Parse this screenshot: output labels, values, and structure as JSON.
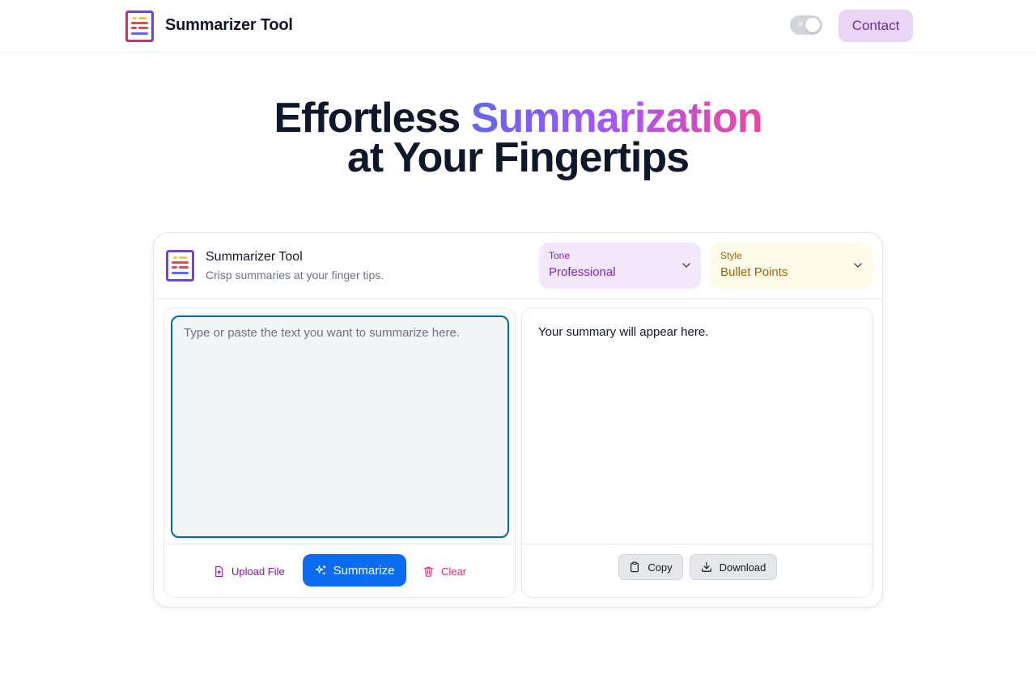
{
  "header": {
    "brand_title": "Summarizer Tool",
    "contact_label": "Contact",
    "logo_icon": "document-lines-icon",
    "theme_icon": "sun-icon"
  },
  "hero": {
    "line1_plain": "Effortless ",
    "line1_highlight": "Summarization",
    "line2": "at Your Fingertips"
  },
  "card": {
    "title": "Summarizer Tool",
    "subtitle": "Crisp summaries at your finger tips.",
    "tone": {
      "label": "Tone",
      "value": "Professional"
    },
    "style": {
      "label": "Style",
      "value": "Bullet Points"
    },
    "input": {
      "placeholder": "Type or paste the text you want to summarize here.",
      "value": ""
    },
    "actions": {
      "upload_label": "Upload File",
      "summarize_label": "Summarize",
      "clear_label": "Clear"
    },
    "output": {
      "text": "Your summary will appear here.",
      "copy_label": "Copy",
      "download_label": "Download"
    }
  },
  "colors": {
    "accent_blue": "#0a6cf1",
    "contact_bg": "#e9d5f5",
    "tone_bg": "#f3e8fb",
    "style_bg": "#fefbe8",
    "gradient": [
      "#6366f1",
      "#a855f7",
      "#ec4899"
    ]
  }
}
